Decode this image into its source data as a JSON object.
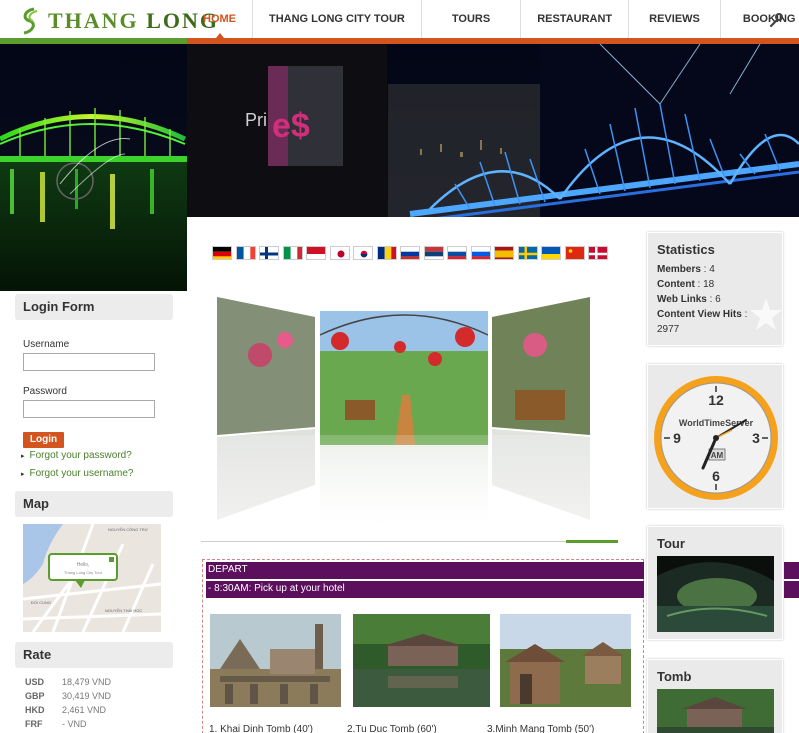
{
  "logo": {
    "text_a": "THANG ",
    "text_b": "LONG"
  },
  "nav": {
    "items": [
      {
        "label": "HOME",
        "active": true
      },
      {
        "label": "THANG LONG CITY TOUR"
      },
      {
        "label": "TOURS"
      },
      {
        "label": "RESTAURANT"
      },
      {
        "label": "REVIEWS"
      },
      {
        "label": "BOOKING"
      }
    ]
  },
  "banner": {
    "overlay_text": "Pri",
    "overlay_symbol": "e$"
  },
  "login": {
    "title": "Login Form",
    "username_label": "Username",
    "username_value": "",
    "password_label": "Password",
    "password_value": "",
    "button": "Login",
    "forgot_password": "Forgot your password?",
    "forgot_username": "Forgot your username?"
  },
  "map": {
    "title": "Map",
    "popup_line1": "Hello,",
    "popup_line2": "Thang Long City Tour",
    "streets": [
      "NGUYỄN CÔNG TRỨ",
      "ĐỐI CUNG",
      "NGUYỄN THÁI HỌC"
    ]
  },
  "rate": {
    "title": "Rate",
    "rows": [
      {
        "cur": "USD",
        "val": "18,479 VND"
      },
      {
        "cur": "GBP",
        "val": "30,419 VND"
      },
      {
        "cur": "HKD",
        "val": "2,461 VND"
      },
      {
        "cur": "FRF",
        "val": "- VND"
      }
    ]
  },
  "depart": {
    "header": "DEPART",
    "item": "- 8:30AM: Pick up at your hotel"
  },
  "tours": [
    {
      "caption": "1. Khai Dinh Tomb (40')"
    },
    {
      "caption": "2.Tu Duc Tomb (60')"
    },
    {
      "caption": "3.Minh Mang Tomb (50')"
    }
  ],
  "stats": {
    "title": "Statistics",
    "members_label": "Members",
    "members": "4",
    "content_label": "Content",
    "content": "18",
    "weblinks_label": "Web Links",
    "weblinks": "6",
    "hits_label": "Content View Hits",
    "hits": "2977"
  },
  "clock": {
    "brand": "WorldTimeServer",
    "ampm": "AM",
    "n12": "12",
    "n3": "3",
    "n6": "6",
    "n9": "9"
  },
  "right_tour": {
    "title": "Tour"
  },
  "right_tomb": {
    "title": "Tomb"
  },
  "colors": {
    "green": "#5a9c2e",
    "orange": "#d4541f",
    "purple": "#5b0f5d"
  },
  "flags": [
    "germany",
    "france",
    "finland",
    "italy",
    "indonesia",
    "japan",
    "south-korea",
    "romania",
    "russia",
    "serbia",
    "slovakia",
    "slovenia",
    "spain",
    "sweden",
    "ukraine",
    "china",
    "denmark"
  ]
}
